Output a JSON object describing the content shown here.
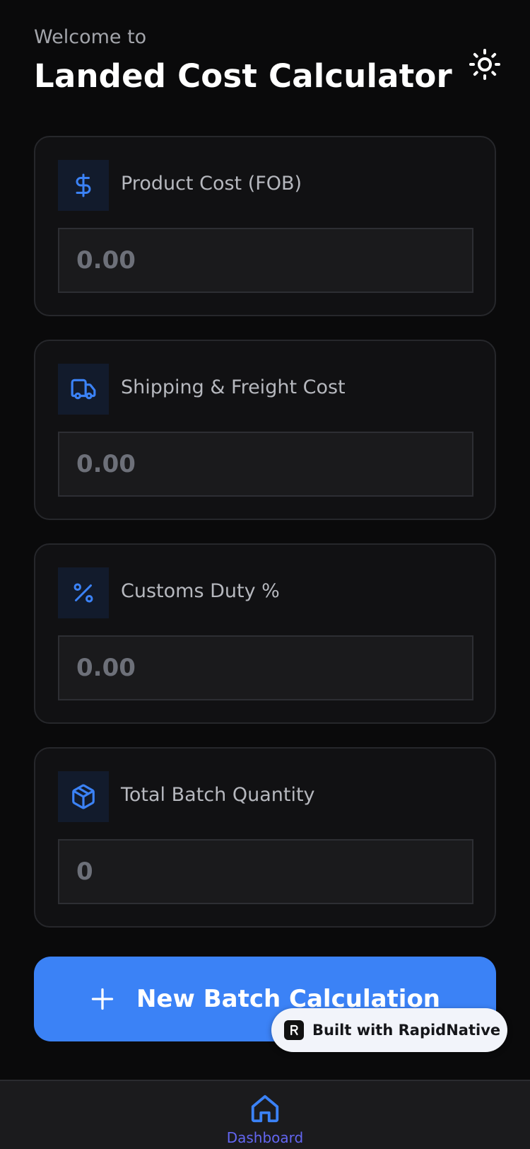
{
  "header": {
    "welcome": "Welcome to",
    "title": "Landed Cost Calculator",
    "theme_icon": "sun-icon"
  },
  "fields": [
    {
      "label": "Product Cost (FOB)",
      "placeholder": "0.00",
      "value": "",
      "icon": "dollar-icon"
    },
    {
      "label": "Shipping & Freight Cost",
      "placeholder": "0.00",
      "value": "",
      "icon": "truck-icon"
    },
    {
      "label": "Customs Duty %",
      "placeholder": "0.00",
      "value": "",
      "icon": "percent-icon"
    },
    {
      "label": "Total Batch Quantity",
      "placeholder": "0",
      "value": "",
      "icon": "package-icon"
    }
  ],
  "action": {
    "label": "New Batch Calculation",
    "icon": "plus-icon"
  },
  "badge": {
    "label": "Built with RapidNative",
    "icon": "rapidnative-logo-icon"
  },
  "tabbar": {
    "items": [
      {
        "label": "Dashboard",
        "icon": "home-icon",
        "active": true
      }
    ]
  },
  "colors": {
    "background": "#0a0a0b",
    "accent": "#3b82f6",
    "active_tab": "#6366f1",
    "card": "#111113"
  }
}
